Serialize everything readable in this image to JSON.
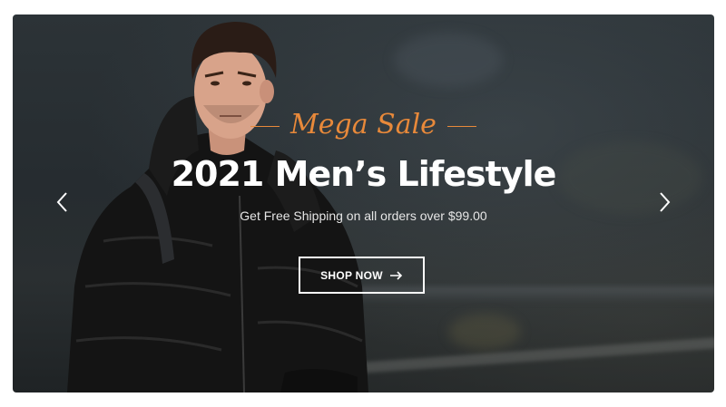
{
  "banner": {
    "tagline": "Mega Sale",
    "headline": "2021 Men’s Lifestyle",
    "subline": "Get Free Shipping on all orders over $99.00",
    "cta_label": "SHOP NOW",
    "cta_icon": "arrow-right-icon",
    "accent_color": "#e8893a",
    "prev_icon": "chevron-left-icon",
    "next_icon": "chevron-right-icon"
  }
}
